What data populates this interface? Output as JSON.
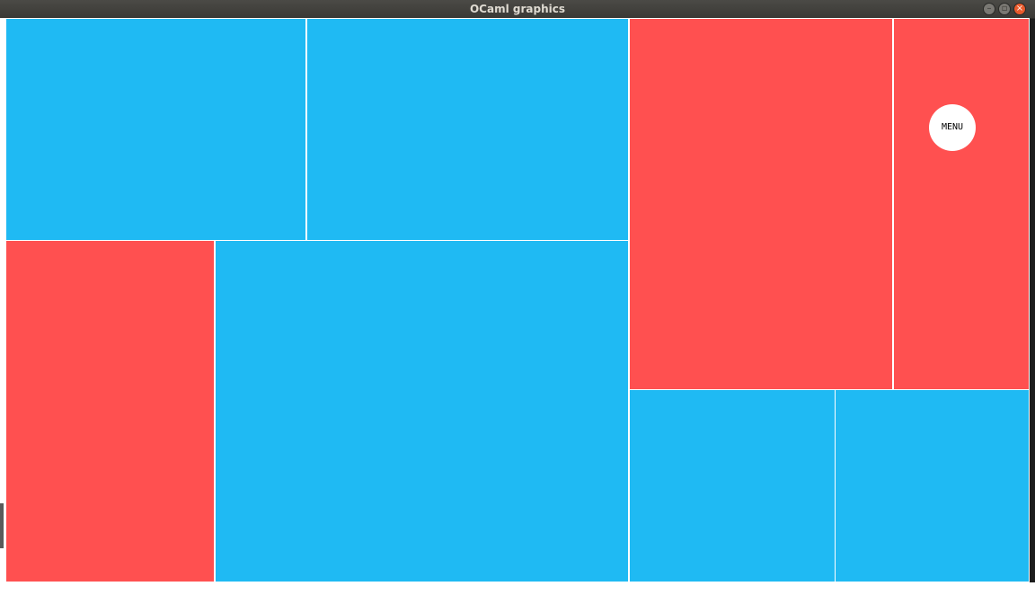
{
  "window": {
    "title": "OCaml graphics"
  },
  "canvas": {
    "menu_button_label": "MENU",
    "colors": {
      "blue": "#1fbaf3",
      "red": "#ff5050",
      "border": "#ffffff"
    },
    "rectangles": [
      {
        "name": "block-top-left",
        "color": "blue"
      },
      {
        "name": "block-top-middle",
        "color": "blue"
      },
      {
        "name": "block-bottom-left",
        "color": "red"
      },
      {
        "name": "block-bottom-middle",
        "color": "blue"
      },
      {
        "name": "block-right-tall",
        "color": "red"
      },
      {
        "name": "block-right-narrow",
        "color": "red"
      },
      {
        "name": "block-bottom-right-1",
        "color": "blue"
      },
      {
        "name": "block-bottom-right-2",
        "color": "blue"
      }
    ]
  },
  "icons": {
    "minimize": "minimize-icon",
    "maximize": "maximize-icon",
    "close": "close-icon"
  }
}
